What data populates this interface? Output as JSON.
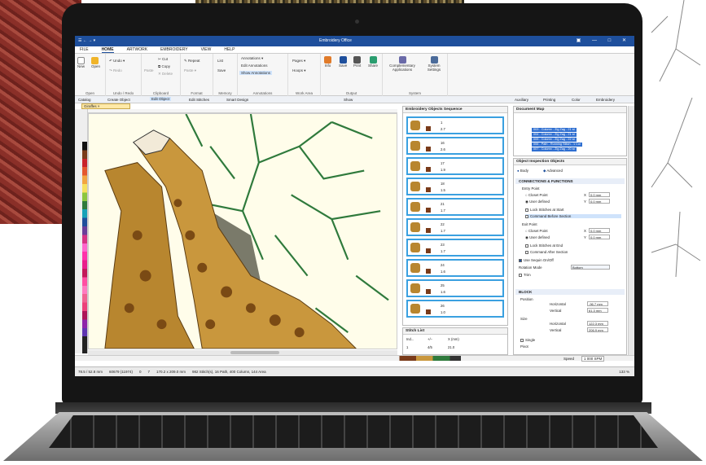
{
  "window": {
    "title": "Embroidery Office",
    "quick_access": "☰ ← → ▾"
  },
  "menu_tabs": [
    "FILE",
    "HOME",
    "ARTWORK",
    "EMBROIDERY",
    "VIEW",
    "HELP"
  ],
  "ribbon": {
    "groups": [
      {
        "label": "Open",
        "buttons": [
          "New",
          "Open"
        ]
      },
      {
        "label": "Undo / Redo",
        "buttons": [
          "Undo ▾",
          "Redo"
        ]
      },
      {
        "label": "Clipboard",
        "buttons": [
          "Paste",
          "Cut",
          "Copy",
          "Delete"
        ]
      },
      {
        "label": "Format",
        "buttons": [
          "Repeat",
          "Paste ▾"
        ]
      },
      {
        "label": "Memory",
        "buttons": [
          "List",
          "Save"
        ]
      },
      {
        "label": "Annotations",
        "buttons": [
          "Annotations ▾",
          "Edit Annotations",
          "Show Annotations"
        ]
      },
      {
        "label": "Work Area",
        "buttons": [
          "Pages ▾",
          "Hoops ▾"
        ]
      },
      {
        "label": "Output",
        "buttons": [
          "Info",
          "Save",
          "Print",
          "Share"
        ]
      },
      {
        "label": "System",
        "buttons": [
          "Complementary Applications",
          "System Settings"
        ]
      }
    ]
  },
  "toolbar": {
    "items": [
      "Catalog",
      "Create Object",
      "Edit Object",
      "Edit Stitches",
      "Smart Design",
      "Show"
    ],
    "right_items": [
      "Auxiliary",
      "Printing",
      "Color",
      "Embroidery"
    ]
  },
  "document_tab": "Giraffes ×",
  "sequence_panel": {
    "title": "Embroidery Objects Sequence",
    "items": [
      {
        "a": "1",
        "b": "2.7"
      },
      {
        "a": "16",
        "b": "2.6"
      },
      {
        "a": "17",
        "b": "1.9"
      },
      {
        "a": "18",
        "b": "1.5"
      },
      {
        "a": "21",
        "b": "1.7"
      },
      {
        "a": "22",
        "b": "1.7"
      },
      {
        "a": "23",
        "b": "1.7"
      },
      {
        "a": "24",
        "b": "1.6"
      },
      {
        "a": "25",
        "b": "1.6"
      },
      {
        "a": "26",
        "b": "1.0"
      }
    ]
  },
  "stitch_list": {
    "title": "Stitch List",
    "col1": "Ind...",
    "col2": "+/−",
    "col3": "X (mm)",
    "row": [
      "1",
      "4/5",
      "21.0"
    ]
  },
  "document_map": {
    "title": "Document Map",
    "items": [
      "003 - Column - Zig Zag - 21 st",
      "004 - Column - Zig Zag - 21 st",
      "005 - Column - Zig Zag - 22 st",
      "006 - Path - Running Stitch - 1 Col",
      "007 - Column - Zig Zag - 20 st"
    ]
  },
  "inspector": {
    "title": "Object Inspection Objects",
    "tabs": [
      "Body",
      "Advanced"
    ],
    "section1": "CONNECTIONS & FUNCTIONS",
    "entry_label": "Entry Point",
    "entry_options": [
      "Closet Point",
      "User defined"
    ],
    "lock_start": "Lock Stitches at Start",
    "cmd_before": "Command Before Section",
    "exit_label": "Exit Point",
    "exit_options": [
      "Closet Point",
      "User defined"
    ],
    "lock_end": "Lock Stitches at End",
    "cmd_after": "Command After Section",
    "sequin": "Use Sequin On/Off",
    "rotation_label": "Rotation Mode",
    "rotation_value": "Bottom",
    "trim": "Trim",
    "x_label": "X",
    "y_label": "Y",
    "entry_x": "0.0 mm",
    "entry_y": "0.0 mm",
    "exit_x": "0.0 mm",
    "exit_y": "0.0 mm",
    "section2": "BLOCK",
    "position_label": "Position",
    "horizontal": "Horizontal",
    "vertical": "Vertical",
    "pos_h": "-96.7 mm",
    "pos_v": "61.3 mm",
    "size_label": "Size",
    "size_h": "122.3 mm",
    "size_v": "206.9 mm",
    "single": "Single",
    "pivot": "Pivot"
  },
  "speed": {
    "label": "Speed",
    "value": "1 000 SPM"
  },
  "status": {
    "items": [
      "78.5 / 52.8 mm",
      "60679 (11974)",
      "0",
      "7",
      "170.2 x 209.0 mm",
      "982 Stitch(s), 16 Path, 400 Column, 144 Area"
    ],
    "zoom": "133 %"
  },
  "colors": {
    "titlebar": "#1e4f9c",
    "selection": "#3aa0e0",
    "giraffe": "#b8862f",
    "tree": "#2f7a3c"
  }
}
